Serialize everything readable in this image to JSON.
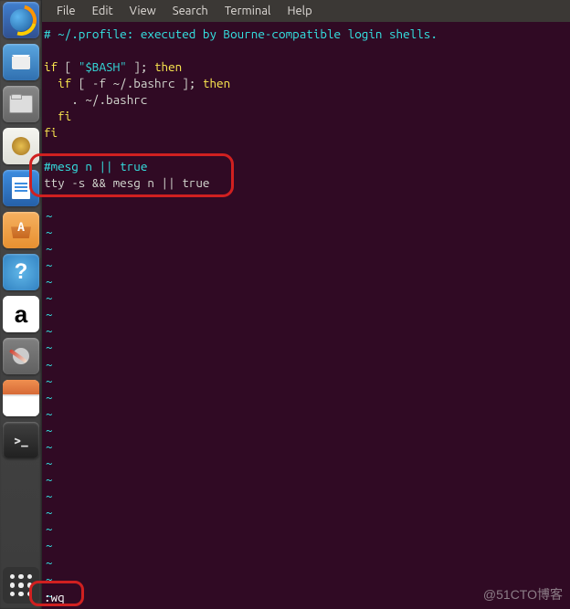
{
  "launcher": {
    "items": [
      {
        "name": "firefox"
      },
      {
        "name": "thunderbird"
      },
      {
        "name": "files"
      },
      {
        "name": "rhythmbox"
      },
      {
        "name": "libreoffice-writer"
      },
      {
        "name": "ubuntu-software"
      },
      {
        "name": "help"
      },
      {
        "name": "amazon"
      },
      {
        "name": "settings"
      },
      {
        "name": "wallpaper"
      },
      {
        "name": "terminal"
      }
    ]
  },
  "menubar": {
    "file": "File",
    "edit": "Edit",
    "view": "View",
    "search": "Search",
    "terminal": "Terminal",
    "help": "Help"
  },
  "editor": {
    "line1_pre": "# ~/.profile: executed by Bourne-compatible login shells.",
    "line3_if": "if",
    "line3_br": " [ ",
    "line3_str": "\"$BASH\"",
    "line3_br2": " ]; ",
    "line3_then": "then",
    "line4_pre": "  ",
    "line4_if": "if",
    "line4_br": " [ -f ~/.bashrc ]; ",
    "line4_then": "then",
    "line5": "    . ~/.bashrc",
    "line6_pre": "  ",
    "line6_fi": "fi",
    "line7_fi": "fi",
    "line9": "#mesg n || true",
    "line10": "tty -s && mesg n || true",
    "tilde": "~",
    "vim_command": ":wq"
  },
  "watermark": "@51CTO博客"
}
